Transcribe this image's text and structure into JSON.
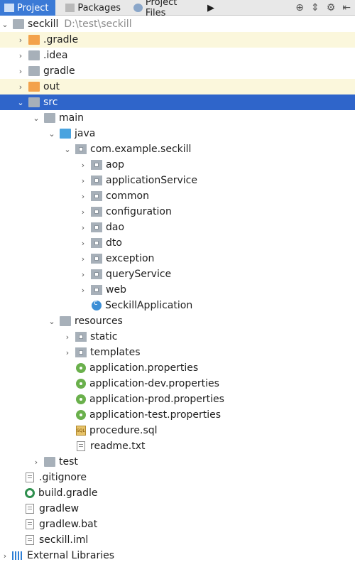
{
  "tabs": [
    {
      "label": "Project",
      "active": true
    },
    {
      "label": "Packages",
      "active": false
    },
    {
      "label": "Project Files",
      "active": false
    }
  ],
  "toolbar": {
    "more": "▶"
  },
  "colors": {
    "selection": "#2f65ca",
    "highlight": "#fbf7dc",
    "orange_folder": "#f3a24b",
    "blue_folder": "#4aa3df"
  },
  "tree": [
    {
      "label": "seckill",
      "path": "D:\\test\\seckill",
      "arrow": "v",
      "icon": "folder-gray"
    },
    {
      "label": ".gradle",
      "arrow": ">",
      "icon": "folder-orange",
      "highlight": true
    },
    {
      "label": ".idea",
      "arrow": ">",
      "icon": "folder-gray"
    },
    {
      "label": "gradle",
      "arrow": ">",
      "icon": "folder-gray"
    },
    {
      "label": "out",
      "arrow": ">",
      "icon": "folder-orange",
      "highlight": true
    },
    {
      "label": "src",
      "arrow": "v",
      "icon": "folder-gray",
      "selected": true
    },
    {
      "label": "main",
      "arrow": "v",
      "icon": "folder-gray"
    },
    {
      "label": "java",
      "arrow": "v",
      "icon": "folder-blue"
    },
    {
      "label": "com.example.seckill",
      "arrow": "v",
      "icon": "package"
    },
    {
      "label": "aop",
      "arrow": ">",
      "icon": "package"
    },
    {
      "label": "applicationService",
      "arrow": ">",
      "icon": "package"
    },
    {
      "label": "common",
      "arrow": ">",
      "icon": "package"
    },
    {
      "label": "configuration",
      "arrow": ">",
      "icon": "package"
    },
    {
      "label": "dao",
      "arrow": ">",
      "icon": "package"
    },
    {
      "label": "dto",
      "arrow": ">",
      "icon": "package"
    },
    {
      "label": "exception",
      "arrow": ">",
      "icon": "package"
    },
    {
      "label": "queryService",
      "arrow": ">",
      "icon": "package"
    },
    {
      "label": "web",
      "arrow": ">",
      "icon": "package"
    },
    {
      "label": "SeckillApplication",
      "arrow": "",
      "icon": "class"
    },
    {
      "label": "resources",
      "arrow": "v",
      "icon": "folder-gray"
    },
    {
      "label": "static",
      "arrow": ">",
      "icon": "package"
    },
    {
      "label": "templates",
      "arrow": ">",
      "icon": "package"
    },
    {
      "label": "application.properties",
      "arrow": "",
      "icon": "spring"
    },
    {
      "label": "application-dev.properties",
      "arrow": "",
      "icon": "spring"
    },
    {
      "label": "application-prod.properties",
      "arrow": "",
      "icon": "spring"
    },
    {
      "label": "application-test.properties",
      "arrow": "",
      "icon": "spring"
    },
    {
      "label": "procedure.sql",
      "arrow": "",
      "icon": "sql"
    },
    {
      "label": "readme.txt",
      "arrow": "",
      "icon": "file"
    },
    {
      "label": "test",
      "arrow": ">",
      "icon": "folder-gray"
    },
    {
      "label": ".gitignore",
      "arrow": "",
      "icon": "file"
    },
    {
      "label": "build.gradle",
      "arrow": "",
      "icon": "gradle"
    },
    {
      "label": "gradlew",
      "arrow": "",
      "icon": "file"
    },
    {
      "label": "gradlew.bat",
      "arrow": "",
      "icon": "file"
    },
    {
      "label": "seckill.iml",
      "arrow": "",
      "icon": "file"
    },
    {
      "label": "External Libraries",
      "arrow": ">",
      "icon": "libraries"
    }
  ]
}
